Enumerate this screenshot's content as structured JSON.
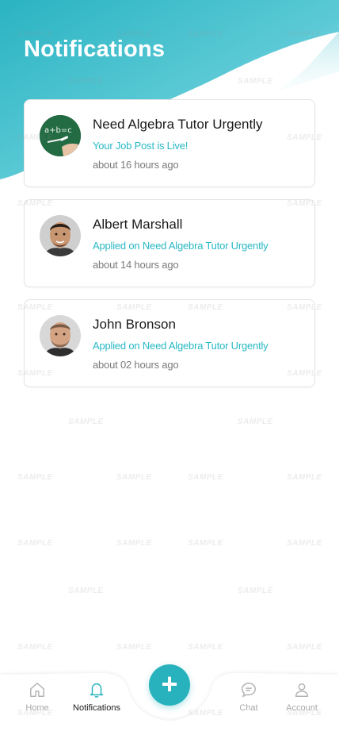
{
  "header": {
    "title": "Notifications"
  },
  "notifications": [
    {
      "title": "Need Algebra Tutor Urgently",
      "subtitle": "Your Job Post is Live!",
      "time": "about 16 hours ago",
      "avatar": "chalkboard-image"
    },
    {
      "title": "Albert Marshall",
      "subtitle": "Applied on Need Algebra Tutor Urgently",
      "time": "about 14 hours ago",
      "avatar": "user-photo"
    },
    {
      "title": "John Bronson",
      "subtitle": "Applied on Need Algebra Tutor Urgently",
      "time": "about 02 hours ago",
      "avatar": "user-photo"
    }
  ],
  "nav": {
    "home": {
      "label": "Home",
      "icon": "home-icon"
    },
    "notifications": {
      "label": "Notifications",
      "icon": "bell-icon"
    },
    "add": {
      "label": "+",
      "icon": "plus-icon"
    },
    "chat": {
      "label": "Chat",
      "icon": "chat-icon"
    },
    "account": {
      "label": "Account",
      "icon": "user-icon"
    }
  },
  "watermark": {
    "text": "SAMPLE"
  },
  "colors": {
    "accent": "#27b2bd",
    "header_gradient_start": "#25b6c4",
    "header_gradient_end": "#c6eef2"
  }
}
